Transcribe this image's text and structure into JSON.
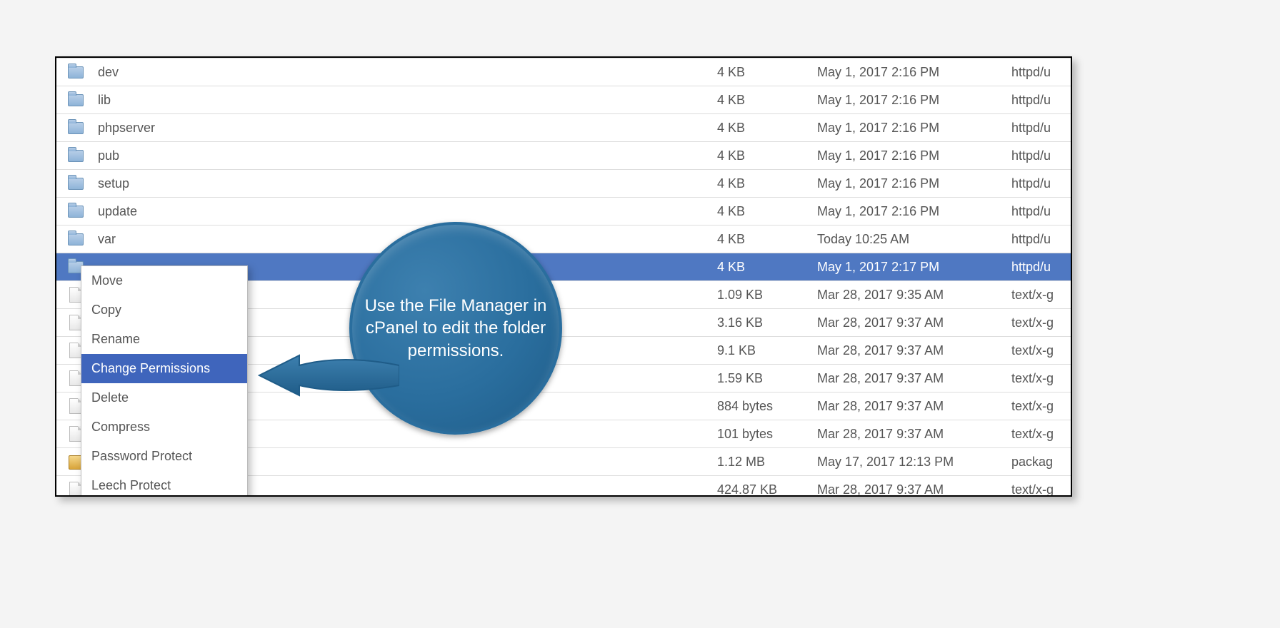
{
  "files": [
    {
      "icon": "folder",
      "name": "dev",
      "size": "4 KB",
      "date": "May 1, 2017 2:16 PM",
      "type": "httpd/u",
      "selected": false
    },
    {
      "icon": "folder",
      "name": "lib",
      "size": "4 KB",
      "date": "May 1, 2017 2:16 PM",
      "type": "httpd/u",
      "selected": false
    },
    {
      "icon": "folder",
      "name": "phpserver",
      "size": "4 KB",
      "date": "May 1, 2017 2:16 PM",
      "type": "httpd/u",
      "selected": false
    },
    {
      "icon": "folder",
      "name": "pub",
      "size": "4 KB",
      "date": "May 1, 2017 2:16 PM",
      "type": "httpd/u",
      "selected": false
    },
    {
      "icon": "folder",
      "name": "setup",
      "size": "4 KB",
      "date": "May 1, 2017 2:16 PM",
      "type": "httpd/u",
      "selected": false
    },
    {
      "icon": "folder",
      "name": "update",
      "size": "4 KB",
      "date": "May 1, 2017 2:16 PM",
      "type": "httpd/u",
      "selected": false
    },
    {
      "icon": "folder",
      "name": "var",
      "size": "4 KB",
      "date": "Today 10:25 AM",
      "type": "httpd/u",
      "selected": false
    },
    {
      "icon": "folder",
      "name": "",
      "size": "4 KB",
      "date": "May 1, 2017 2:17 PM",
      "type": "httpd/u",
      "selected": true
    },
    {
      "icon": "file",
      "name": "",
      "size": "1.09 KB",
      "date": "Mar 28, 2017 9:35 AM",
      "type": "text/x-g",
      "selected": false
    },
    {
      "icon": "file",
      "name": "",
      "size": "3.16 KB",
      "date": "Mar 28, 2017 9:37 AM",
      "type": "text/x-g",
      "selected": false
    },
    {
      "icon": "file",
      "name": "",
      "size": "9.1 KB",
      "date": "Mar 28, 2017 9:37 AM",
      "type": "text/x-g",
      "selected": false
    },
    {
      "icon": "file",
      "name": "",
      "size": "1.59 KB",
      "date": "Mar 28, 2017 9:37 AM",
      "type": "text/x-g",
      "selected": false
    },
    {
      "icon": "file",
      "name": "",
      "size": "884 bytes",
      "date": "Mar 28, 2017 9:37 AM",
      "type": "text/x-g",
      "selected": false
    },
    {
      "icon": "file",
      "name": "",
      "size": "101 bytes",
      "date": "Mar 28, 2017 9:37 AM",
      "type": "text/x-g",
      "selected": false
    },
    {
      "icon": "package",
      "name": "",
      "size": "1.12 MB",
      "date": "May 17, 2017 12:13 PM",
      "type": "packag",
      "selected": false
    },
    {
      "icon": "file",
      "name": "",
      "size": "424.87 KB",
      "date": "Mar 28, 2017 9:37 AM",
      "type": "text/x-g",
      "selected": false
    }
  ],
  "context_menu": {
    "items": [
      {
        "label": "Move",
        "selected": false
      },
      {
        "label": "Copy",
        "selected": false
      },
      {
        "label": "Rename",
        "selected": false
      },
      {
        "label": "Change Permissions",
        "selected": true
      },
      {
        "label": "Delete",
        "selected": false
      },
      {
        "label": "Compress",
        "selected": false
      },
      {
        "label": "Password Protect",
        "selected": false
      },
      {
        "label": "Leech Protect",
        "selected": false
      }
    ]
  },
  "annotation": {
    "text": "Use the File Manager in cPanel to edit the folder permissions."
  }
}
